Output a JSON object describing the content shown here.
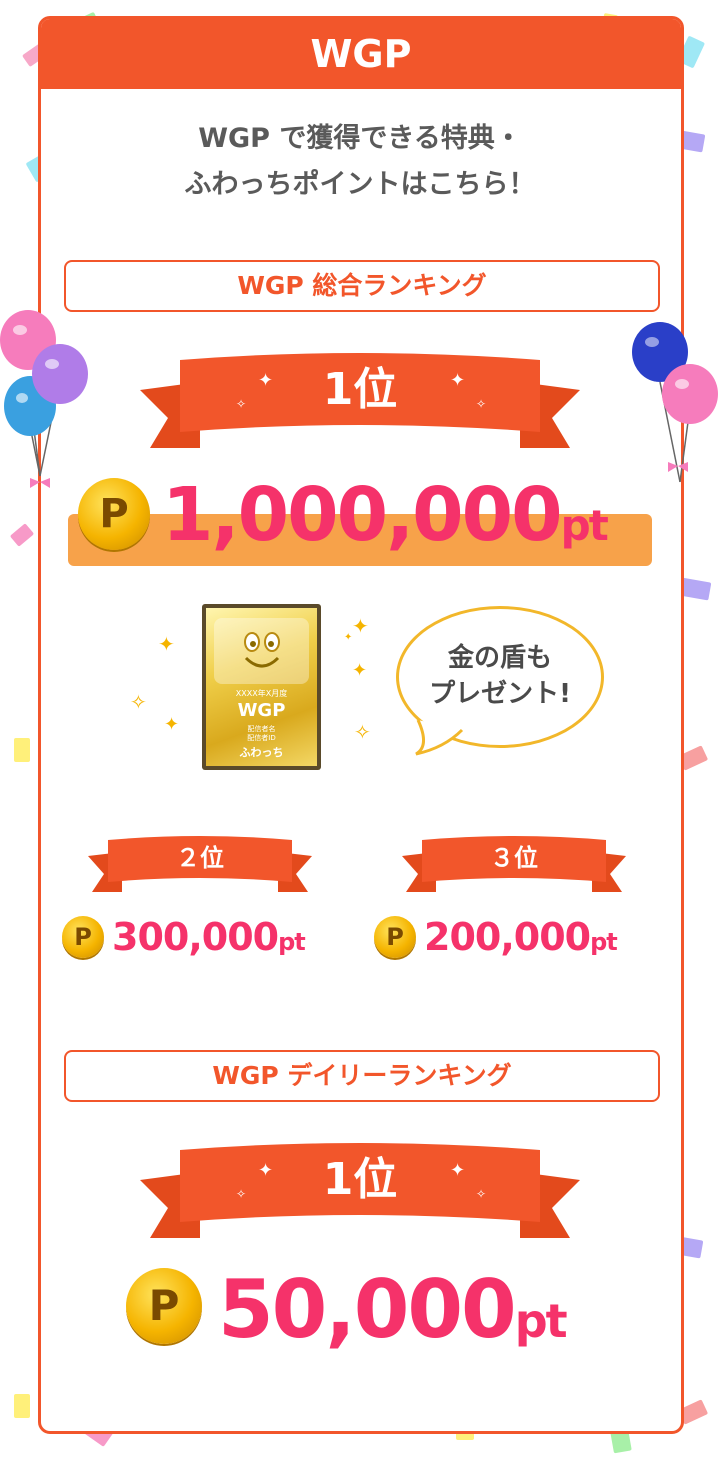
{
  "header": {
    "title": "WGP"
  },
  "intro": {
    "line1": "WGP で獲得できる特典・",
    "line2": "ふわっちポイントはこちら！"
  },
  "overall": {
    "section_title": "WGP 総合ランキング",
    "first": {
      "rank": "1位",
      "amount": "1,000,000",
      "unit": "pt"
    },
    "shield": {
      "period": "XXXX年X月度",
      "title": "WGP",
      "role": "配信者名",
      "id": "配信者ID",
      "brand": "ふわっち"
    },
    "bubble": {
      "line1": "金の盾も",
      "line2": "プレゼント!"
    },
    "second": {
      "rank": "２位",
      "amount": "300,000",
      "unit": "pt"
    },
    "third": {
      "rank": "３位",
      "amount": "200,000",
      "unit": "pt"
    }
  },
  "daily": {
    "section_title": "WGP デイリーランキング",
    "first": {
      "rank": "1位",
      "amount": "50,000",
      "unit": "pt"
    }
  },
  "coin_label": "P",
  "colors": {
    "brand": "#f2562b",
    "amount": "#f5326a",
    "gold": "#f5b400"
  }
}
